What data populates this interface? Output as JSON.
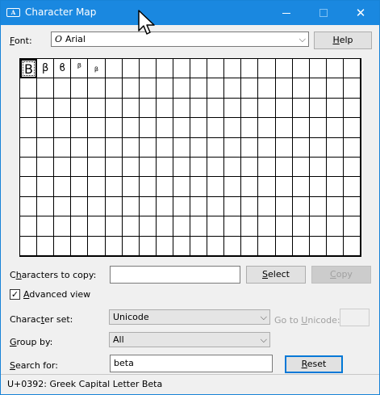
{
  "window": {
    "title": "Character Map",
    "icon": "charmap-app-icon",
    "icon_text": "A"
  },
  "font_row": {
    "label_prefix": "",
    "label_ul": "F",
    "label_rest": "ont:",
    "value_prefix": "O",
    "value": "Arial",
    "help_ul": "H",
    "help_rest": "elp"
  },
  "grid": {
    "characters": [
      "Β",
      "β",
      "ϐ",
      "ᵝ",
      "ᵦ"
    ]
  },
  "copy_row": {
    "label_prefix": "C",
    "label_ul": "h",
    "label_rest": "aracters to copy:",
    "value": "",
    "select_ul": "S",
    "select_rest": "elect",
    "copy_ul": "C",
    "copy_rest": "opy"
  },
  "advanced_view": {
    "checked": true,
    "check_glyph": "✓",
    "label_ul": "A",
    "label_rest": "dvanced view"
  },
  "charset_row": {
    "label_prefix": "Charac",
    "label_ul": "t",
    "label_rest": "er set:",
    "value": "Unicode",
    "goto_prefix": "Go to ",
    "goto_ul": "U",
    "goto_rest": "nicode:",
    "goto_value": ""
  },
  "group_row": {
    "label_ul": "G",
    "label_rest": "roup by:",
    "value": "All"
  },
  "search_row": {
    "label_ul": "S",
    "label_rest": "earch for:",
    "value": "beta",
    "reset_ul": "R",
    "reset_rest": "eset"
  },
  "status": {
    "text": "U+0392: Greek Capital Letter Beta"
  },
  "colors": {
    "titlebar": "#1a88e0",
    "accent": "#0078d7"
  }
}
